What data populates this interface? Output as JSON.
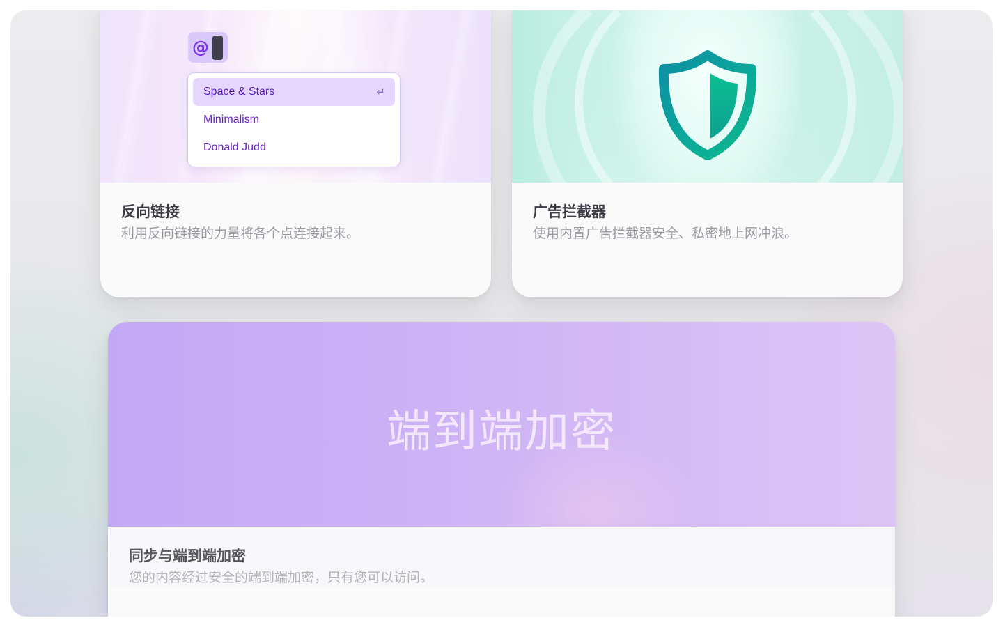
{
  "cards": {
    "backlinks": {
      "title": "反向链接",
      "description": "利用反向链接的力量将各个点连接起来。",
      "mention": {
        "trigger": "@",
        "items": [
          {
            "label": "Space & Stars",
            "selected": true
          },
          {
            "label": "Minimalism",
            "selected": false
          },
          {
            "label": "Donald Judd",
            "selected": false
          }
        ],
        "enter_glyph": "↵"
      }
    },
    "adblock": {
      "title": "广告拦截器",
      "description": "使用内置广告拦截器安全、私密地上网冲浪。",
      "icon": "shield-icon"
    },
    "e2e": {
      "banner_text": "端到端加密",
      "title": "同步与端到端加密",
      "description": "您的内容经过安全的端到端加密，只有您可以访问。"
    }
  },
  "colors": {
    "accent_purple": "#7a35e8",
    "shield_teal": "#0d9f8e",
    "e2e_banner": "#c3a9f5"
  }
}
